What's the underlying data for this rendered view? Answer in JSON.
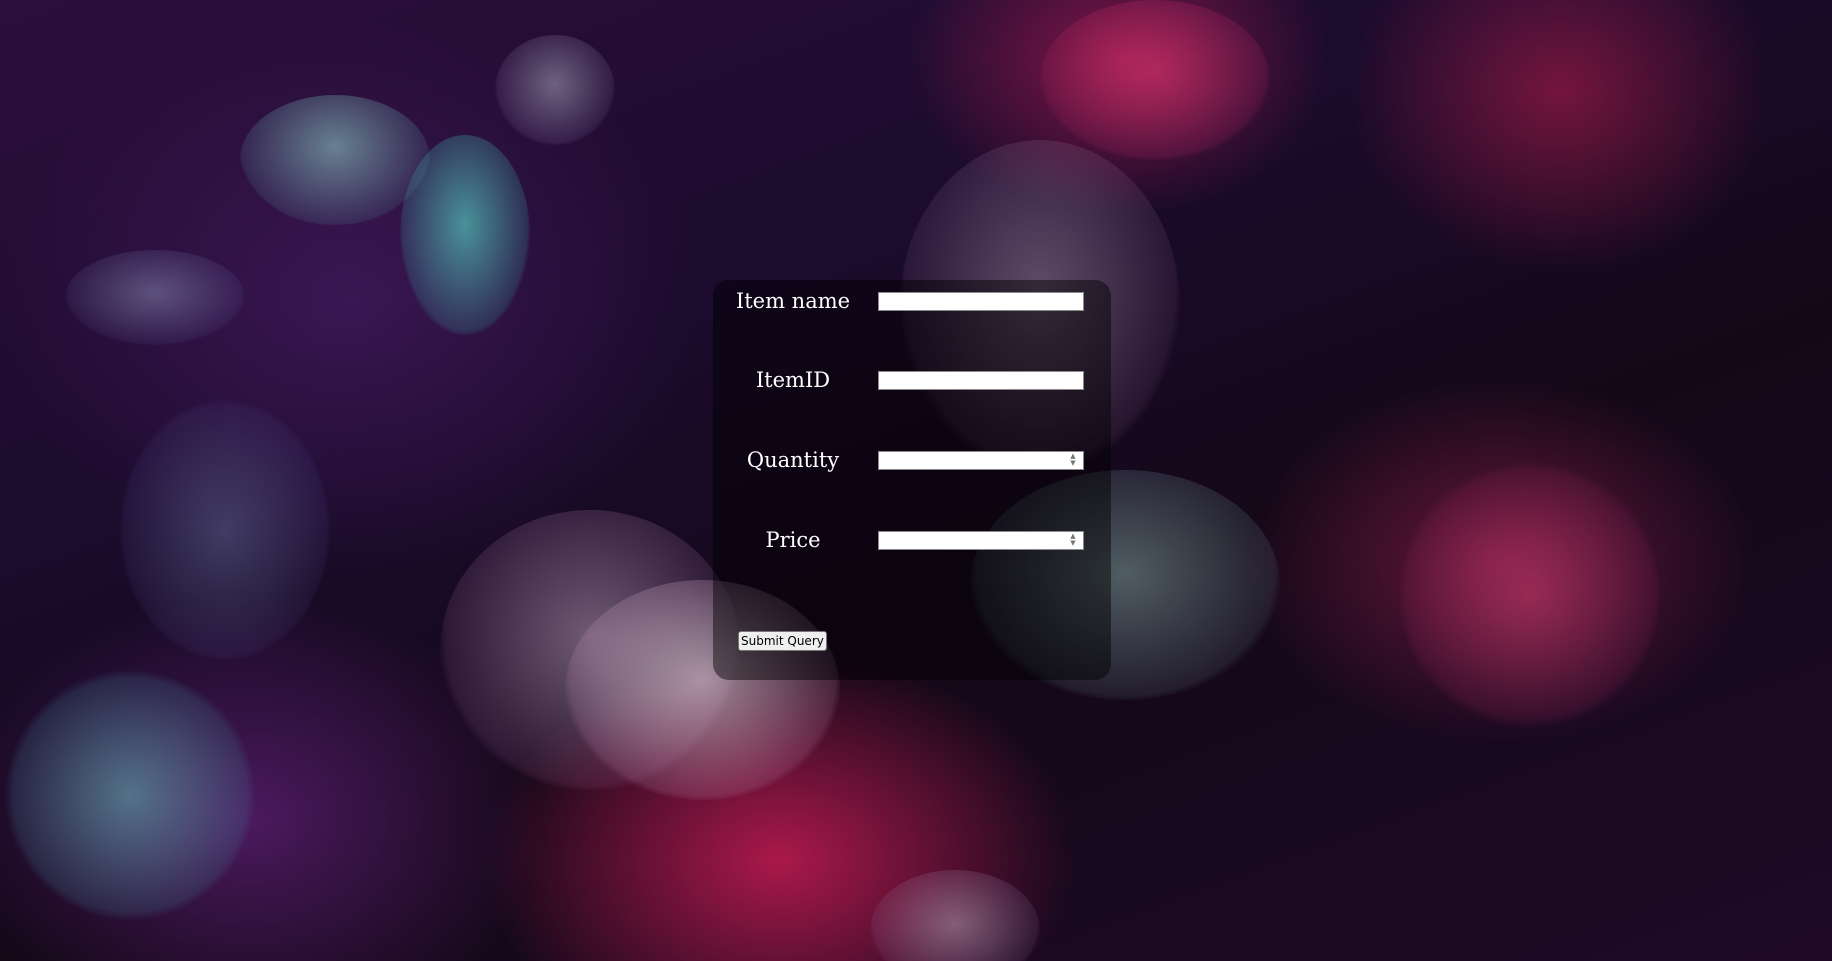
{
  "form": {
    "fields": [
      {
        "label": "Item name",
        "value": "",
        "type": "text"
      },
      {
        "label": "ItemID",
        "value": "",
        "type": "text"
      },
      {
        "label": "Quantity",
        "value": "",
        "type": "number"
      },
      {
        "label": "Price",
        "value": "",
        "type": "number"
      }
    ],
    "submit_label": "Submit Query"
  },
  "icons": {
    "spinner_up": "spin-up-icon",
    "spinner_down": "spin-down-icon"
  },
  "colors": {
    "panel_background": "rgba(0,0,0,0.45)",
    "label_text": "#ffffff",
    "field_background": "#ffffff"
  }
}
